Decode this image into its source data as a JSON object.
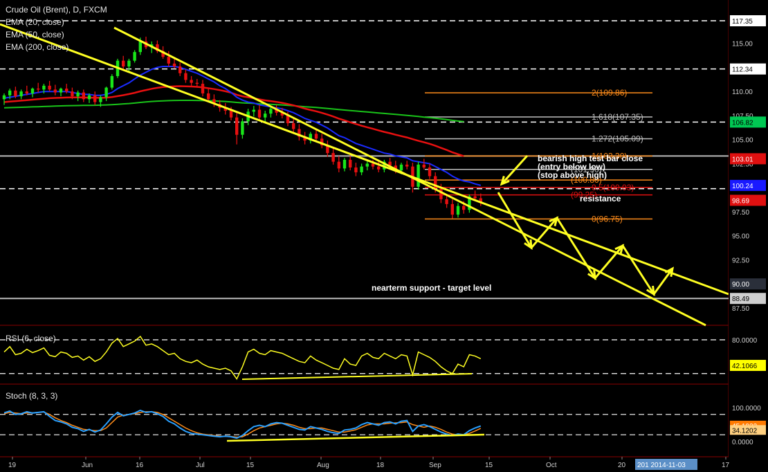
{
  "legend": {
    "title": "Crude Oil (Brent), D, FXCM",
    "ema20": "EMA (20, close)",
    "ema50": "EMA (50, close)",
    "ema200": "EMA (200, close)",
    "rsi": "RSI (6, close)",
    "stoch": "Stoch (8, 3, 3)"
  },
  "annotations": {
    "bearish_1": "bearish high test bar close",
    "bearish_2": "(entry below low)",
    "bearish_3": "(stop above high)",
    "resistance": "resistance",
    "support": "nearterm support - target level"
  },
  "price_axis": {
    "ticks": [
      "115.00",
      "112.50",
      "110.00",
      "107.50",
      "105.00",
      "102.50",
      "100.00",
      "97.50",
      "95.00",
      "92.50",
      "90.00",
      "87.50"
    ],
    "tags": [
      {
        "label": "117.35",
        "value": 117.35,
        "bg": "#ffffff",
        "fg": "#000000"
      },
      {
        "label": "112.34",
        "value": 112.34,
        "bg": "#ffffff",
        "fg": "#000000"
      },
      {
        "label": "106.82",
        "value": 106.82,
        "bg": "#00c853",
        "fg": "#000000"
      },
      {
        "label": "103.01",
        "value": 103.01,
        "bg": "#e01010",
        "fg": "#ffffff"
      },
      {
        "label": "100.24",
        "value": 100.24,
        "bg": "#1a1aff",
        "fg": "#ffffff"
      },
      {
        "label": "98.69",
        "value": 98.69,
        "bg": "#e01010",
        "fg": "#ffffff"
      },
      {
        "label": "90.00",
        "value": 90.0,
        "bg": "#2a2f3a",
        "fg": "#ffffff"
      },
      {
        "label": "88.49",
        "value": 88.49,
        "bg": "#cfcfcf",
        "fg": "#000000"
      }
    ]
  },
  "rsi_axis": {
    "ticks": [
      "80.0000"
    ],
    "tag": {
      "label": "42.1066",
      "bg": "#ffff00",
      "fg": "#000000"
    }
  },
  "stoch_axis": {
    "ticks": [
      "100.0000",
      "0.0000"
    ],
    "tags": [
      {
        "label": "45.1922",
        "bg": "#ff7a00",
        "fg": "#ffffff"
      },
      {
        "label": "34.1202",
        "bg": "#ffd080",
        "fg": "#000000"
      }
    ]
  },
  "time_axis": {
    "ticks": [
      "19",
      "Jun",
      "16",
      "Jul",
      "15",
      "Aug",
      "18",
      "Sep",
      "15",
      "Oct",
      "20",
      "17"
    ],
    "date_tag": "201 2014-11-03"
  },
  "fib_levels": [
    {
      "label": "2(109.86)",
      "value": 109.86,
      "color": "#ff8c1a"
    },
    {
      "label": "1.618(107.35)",
      "value": 107.35,
      "color": "#bfbfbf"
    },
    {
      "label": "1.272(105.09)",
      "value": 105.09,
      "color": "#bfbfbf"
    },
    {
      "label": "1(103.30)",
      "value": 103.3,
      "color": "#ff8c1a"
    },
    {
      "label": "(101.90)",
      "value": 101.9,
      "color": "#bfbfbf"
    },
    {
      "label": "(100.80)",
      "value": 100.8,
      "color": "#ff8c1a"
    },
    {
      "label": "0.5(100.03)",
      "value": 100.03,
      "color": "#e01010"
    },
    {
      "label": "(99.25)",
      "value": 99.25,
      "color": "#e01010"
    },
    {
      "label": "0(96.75)",
      "value": 96.75,
      "color": "#ff8c1a"
    }
  ],
  "horizontal_levels": {
    "dashed": [
      117.35,
      112.34,
      106.82,
      99.9
    ],
    "solid": [
      103.3,
      88.49
    ]
  },
  "chart_data": {
    "type": "line",
    "title": "Crude Oil (Brent), D, FXCM",
    "ylim": [
      86.5,
      118.0
    ],
    "x": [
      "May 19",
      "Jun",
      "Jun 16",
      "Jul",
      "Jul 15",
      "Aug",
      "Aug 18",
      "Sep",
      "Sep 15",
      "Oct",
      "Oct 20",
      "Nov 17"
    ],
    "candles": [
      [
        109.2,
        109.8,
        108.6,
        109.6
      ],
      [
        109.6,
        110.3,
        109.2,
        110.1
      ],
      [
        110.1,
        110.5,
        109.3,
        109.5
      ],
      [
        109.5,
        110.2,
        109.2,
        110.0
      ],
      [
        110.0,
        110.6,
        109.6,
        109.8
      ],
      [
        109.8,
        110.4,
        109.4,
        110.3
      ],
      [
        110.3,
        110.9,
        109.9,
        110.2
      ],
      [
        110.2,
        110.8,
        109.8,
        110.6
      ],
      [
        110.6,
        111.1,
        110.0,
        110.2
      ],
      [
        110.2,
        110.7,
        109.6,
        109.9
      ],
      [
        109.9,
        110.4,
        109.5,
        110.3
      ],
      [
        110.3,
        110.8,
        109.8,
        110.0
      ],
      [
        110.0,
        110.4,
        109.2,
        109.5
      ],
      [
        109.5,
        110.1,
        109.0,
        109.9
      ],
      [
        109.9,
        110.2,
        108.9,
        109.2
      ],
      [
        109.2,
        109.8,
        108.8,
        109.6
      ],
      [
        109.6,
        110.0,
        108.6,
        108.9
      ],
      [
        108.9,
        109.6,
        108.4,
        109.4
      ],
      [
        109.4,
        110.5,
        109.0,
        110.4
      ],
      [
        110.4,
        111.8,
        110.2,
        111.6
      ],
      [
        111.6,
        113.4,
        111.4,
        113.2
      ],
      [
        113.2,
        113.7,
        112.2,
        112.6
      ],
      [
        112.6,
        113.4,
        112.1,
        113.2
      ],
      [
        113.2,
        114.3,
        113.0,
        114.1
      ],
      [
        114.1,
        115.6,
        113.8,
        115.2
      ],
      [
        115.2,
        115.7,
        114.4,
        114.6
      ],
      [
        114.6,
        115.2,
        114.0,
        114.9
      ],
      [
        114.9,
        115.3,
        114.0,
        114.2
      ],
      [
        114.2,
        114.7,
        113.4,
        113.6
      ],
      [
        113.6,
        114.2,
        112.6,
        112.9
      ],
      [
        112.9,
        113.5,
        112.4,
        112.6
      ],
      [
        112.6,
        113.0,
        111.6,
        111.9
      ],
      [
        111.9,
        112.3,
        110.9,
        111.2
      ],
      [
        111.2,
        111.6,
        110.6,
        110.9
      ],
      [
        110.9,
        111.3,
        110.4,
        110.8
      ],
      [
        110.8,
        111.2,
        109.5,
        109.8
      ],
      [
        109.8,
        110.3,
        108.9,
        109.2
      ],
      [
        109.2,
        109.7,
        108.4,
        108.7
      ],
      [
        108.7,
        109.1,
        107.9,
        108.3
      ],
      [
        108.3,
        108.8,
        107.6,
        108.0
      ],
      [
        108.0,
        108.4,
        107.0,
        107.3
      ],
      [
        107.3,
        107.8,
        104.5,
        105.5
      ],
      [
        105.5,
        107.2,
        105.1,
        106.9
      ],
      [
        106.9,
        108.2,
        106.5,
        107.9
      ],
      [
        107.9,
        108.5,
        107.4,
        108.1
      ],
      [
        108.1,
        108.6,
        107.0,
        107.3
      ],
      [
        107.3,
        108.0,
        106.8,
        107.7
      ],
      [
        107.7,
        108.5,
        107.3,
        108.2
      ],
      [
        108.2,
        108.6,
        107.5,
        107.8
      ],
      [
        107.8,
        108.3,
        107.2,
        107.5
      ],
      [
        107.5,
        107.9,
        106.4,
        106.7
      ],
      [
        106.7,
        107.2,
        105.8,
        106.1
      ],
      [
        106.1,
        106.6,
        104.9,
        105.3
      ],
      [
        105.3,
        105.8,
        104.5,
        104.9
      ],
      [
        104.9,
        105.8,
        104.6,
        105.6
      ],
      [
        105.6,
        106.0,
        104.8,
        105.1
      ],
      [
        105.1,
        105.6,
        104.1,
        104.4
      ],
      [
        104.4,
        104.9,
        103.2,
        103.6
      ],
      [
        103.6,
        104.1,
        102.4,
        102.7
      ],
      [
        102.7,
        103.3,
        101.6,
        102.0
      ],
      [
        102.0,
        103.1,
        101.7,
        102.9
      ],
      [
        102.9,
        103.3,
        101.8,
        102.1
      ],
      [
        102.1,
        102.6,
        101.2,
        101.6
      ],
      [
        101.6,
        102.5,
        101.3,
        102.2
      ],
      [
        102.2,
        102.8,
        101.8,
        102.5
      ],
      [
        102.5,
        102.9,
        101.9,
        102.2
      ],
      [
        102.2,
        102.7,
        101.6,
        101.9
      ],
      [
        101.9,
        102.9,
        101.6,
        102.7
      ],
      [
        102.7,
        103.1,
        102.0,
        102.3
      ],
      [
        102.3,
        102.8,
        101.5,
        101.8
      ],
      [
        101.8,
        102.6,
        101.4,
        102.4
      ],
      [
        102.4,
        102.8,
        101.9,
        102.2
      ],
      [
        102.2,
        102.6,
        99.5,
        100.1
      ],
      [
        100.1,
        102.7,
        99.8,
        102.4
      ],
      [
        102.4,
        103.0,
        101.9,
        102.1
      ],
      [
        102.1,
        102.5,
        100.9,
        101.2
      ],
      [
        101.2,
        101.6,
        99.5,
        99.9
      ],
      [
        99.9,
        100.4,
        98.4,
        98.8
      ],
      [
        98.8,
        99.3,
        97.9,
        98.3
      ],
      [
        98.3,
        98.8,
        96.8,
        97.2
      ],
      [
        97.2,
        98.4,
        96.9,
        98.1
      ],
      [
        98.1,
        98.6,
        97.3,
        97.7
      ],
      [
        97.7,
        99.3,
        97.4,
        99.1
      ],
      [
        99.1,
        99.7,
        98.6,
        98.9
      ],
      [
        98.9,
        99.4,
        98.1,
        98.4
      ]
    ],
    "ema20": [
      109.3,
      109.4,
      109.5,
      109.6,
      109.7,
      109.8,
      109.9,
      110.0,
      110.0,
      110.0,
      110.0,
      110.0,
      109.9,
      109.8,
      109.7,
      109.7,
      109.6,
      109.6,
      109.7,
      109.9,
      110.3,
      110.6,
      110.9,
      111.3,
      111.7,
      112.0,
      112.3,
      112.5,
      112.6,
      112.6,
      112.6,
      112.5,
      112.3,
      112.1,
      111.9,
      111.6,
      111.3,
      111.0,
      110.6,
      110.3,
      109.9,
      109.4,
      109.1,
      108.9,
      108.8,
      108.6,
      108.5,
      108.4,
      108.3,
      108.2,
      108.0,
      107.8,
      107.5,
      107.2,
      107.0,
      106.8,
      106.5,
      106.2,
      105.8,
      105.4,
      105.2,
      104.9,
      104.6,
      104.4,
      104.2,
      104.0,
      103.8,
      103.6,
      103.5,
      103.3,
      103.2,
      103.1,
      102.8,
      102.7,
      102.6,
      102.5,
      102.2,
      101.9,
      101.6,
      101.2,
      100.9,
      100.7,
      100.6,
      100.4,
      100.24
    ],
    "ema50": [
      108.9,
      108.95,
      109.0,
      109.05,
      109.1,
      109.15,
      109.2,
      109.25,
      109.3,
      109.33,
      109.35,
      109.37,
      109.38,
      109.38,
      109.37,
      109.36,
      109.35,
      109.34,
      109.36,
      109.42,
      109.52,
      109.62,
      109.73,
      109.86,
      110.02,
      110.15,
      110.28,
      110.38,
      110.46,
      110.5,
      110.54,
      110.55,
      110.54,
      110.52,
      110.48,
      110.42,
      110.34,
      110.25,
      110.14,
      110.02,
      109.88,
      109.66,
      109.5,
      109.4,
      109.3,
      109.18,
      109.08,
      109.0,
      108.92,
      108.82,
      108.7,
      108.56,
      108.4,
      108.22,
      108.08,
      107.94,
      107.78,
      107.6,
      107.4,
      107.18,
      107.0,
      106.8,
      106.62,
      106.44,
      106.28,
      106.12,
      105.96,
      105.8,
      105.66,
      105.5,
      105.36,
      105.22,
      105.04,
      104.88,
      104.72,
      104.56,
      104.36,
      104.14,
      103.92,
      103.68,
      103.48,
      103.28
    ],
    "ema200": [
      108.3,
      108.32,
      108.34,
      108.36,
      108.38,
      108.4,
      108.42,
      108.44,
      108.46,
      108.48,
      108.5,
      108.52,
      108.53,
      108.54,
      108.55,
      108.56,
      108.57,
      108.58,
      108.6,
      108.63,
      108.67,
      108.71,
      108.75,
      108.8,
      108.86,
      108.91,
      108.96,
      109.0,
      109.03,
      109.05,
      109.07,
      109.08,
      109.08,
      109.08,
      109.07,
      109.06,
      109.04,
      109.02,
      108.99,
      108.96,
      108.92,
      108.86,
      108.82,
      108.79,
      108.76,
      108.72,
      108.69,
      108.66,
      108.63,
      108.6,
      108.56,
      108.52,
      108.47,
      108.42,
      108.38,
      108.34,
      108.29,
      108.24,
      108.18,
      108.12,
      108.07,
      108.02,
      107.97,
      107.92,
      107.87,
      107.82,
      107.77,
      107.72,
      107.67,
      107.62,
      107.57,
      107.52,
      107.46,
      107.4,
      107.34,
      107.28,
      107.22,
      107.15,
      107.08,
      107.0,
      106.93,
      106.86
    ],
    "rsi": [
      62,
      70,
      58,
      60,
      66,
      61,
      64,
      68,
      57,
      55,
      62,
      60,
      54,
      56,
      50,
      55,
      48,
      52,
      62,
      75,
      82,
      70,
      74,
      78,
      85,
      72,
      74,
      70,
      64,
      58,
      60,
      52,
      48,
      46,
      50,
      44,
      40,
      38,
      36,
      38,
      34,
      22,
      40,
      62,
      66,
      60,
      58,
      64,
      62,
      60,
      56,
      52,
      48,
      46,
      56,
      50,
      46,
      42,
      38,
      36,
      52,
      44,
      42,
      56,
      60,
      54,
      52,
      60,
      56,
      52,
      58,
      56,
      28,
      62,
      58,
      54,
      48,
      40,
      34,
      30,
      44,
      40,
      58,
      56,
      52
    ],
    "stoch_k": [
      85,
      90,
      80,
      82,
      88,
      84,
      86,
      88,
      74,
      62,
      58,
      52,
      42,
      38,
      30,
      36,
      28,
      34,
      52,
      72,
      86,
      76,
      80,
      84,
      92,
      86,
      88,
      82,
      74,
      60,
      52,
      40,
      30,
      24,
      22,
      20,
      18,
      16,
      14,
      16,
      14,
      10,
      18,
      32,
      44,
      48,
      44,
      52,
      56,
      54,
      48,
      42,
      36,
      34,
      44,
      40,
      36,
      30,
      26,
      24,
      34,
      36,
      40,
      50,
      56,
      52,
      48,
      56,
      58,
      52,
      60,
      62,
      30,
      46,
      50,
      44,
      36,
      28,
      22,
      18,
      22,
      20,
      32,
      40,
      46
    ],
    "stoch_d": [
      82,
      86,
      84,
      82,
      84,
      85,
      86,
      87,
      80,
      70,
      62,
      56,
      48,
      42,
      36,
      34,
      32,
      32,
      40,
      56,
      72,
      78,
      80,
      82,
      86,
      88,
      88,
      86,
      80,
      70,
      60,
      50,
      40,
      32,
      26,
      22,
      20,
      18,
      16,
      15,
      15,
      13,
      14,
      22,
      32,
      40,
      44,
      48,
      52,
      54,
      52,
      48,
      42,
      38,
      38,
      40,
      40,
      36,
      32,
      28,
      28,
      31,
      35,
      42,
      49,
      52,
      52,
      52,
      54,
      55,
      56,
      58,
      50,
      46,
      42,
      46,
      42,
      36,
      28,
      22,
      20,
      20,
      24,
      31,
      39
    ]
  }
}
